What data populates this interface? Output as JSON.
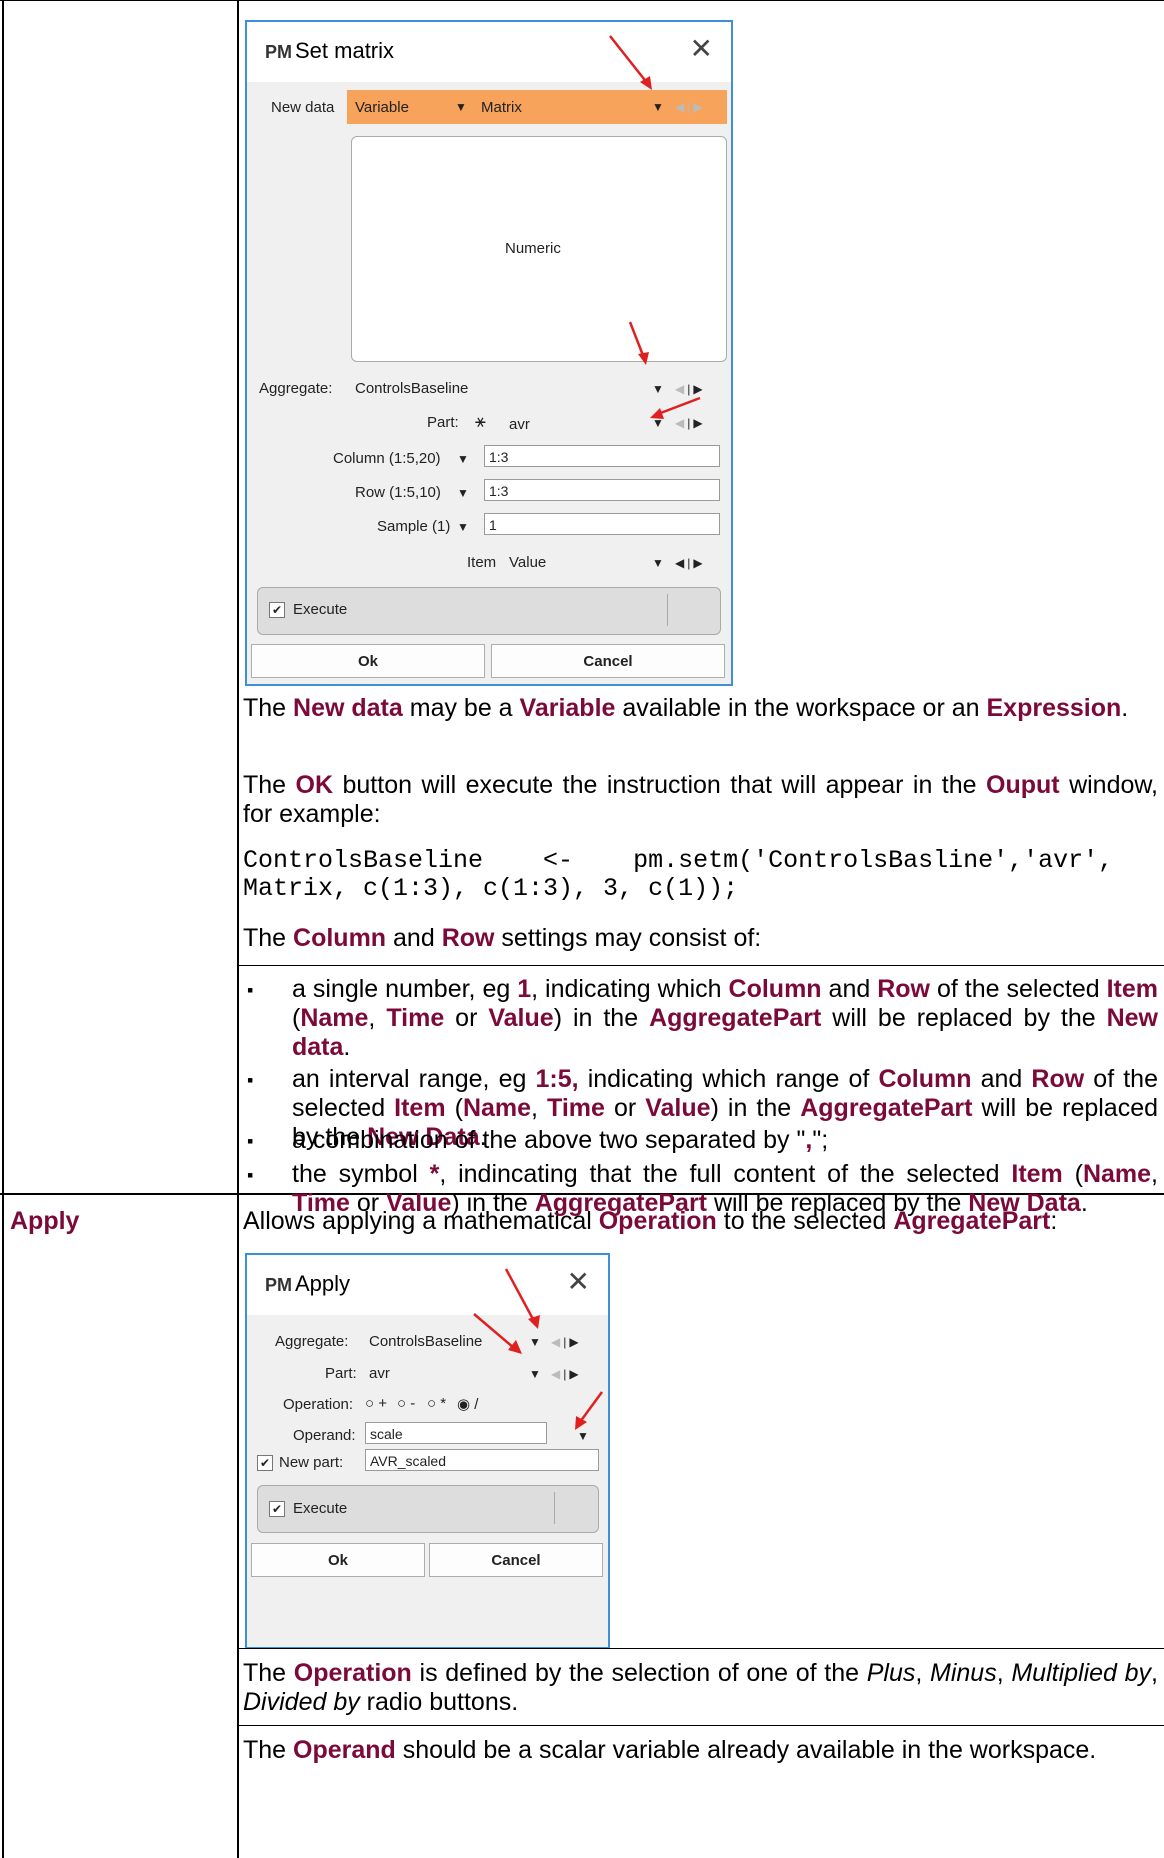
{
  "set_matrix_dialog": {
    "title": "Set matrix",
    "logo": "PM",
    "new_data_label": "New data",
    "new_data_type": "Variable",
    "new_data_value": "Matrix",
    "list_item": "Numeric",
    "aggregate_label": "Aggregate:",
    "aggregate_value": "ControlsBaseline",
    "part_label": "Part:",
    "part_value": "avr",
    "column_label": "Column (1:5,20)",
    "column_value": "1:3",
    "row_label": "Row (1:5,10)",
    "row_value": "1:3",
    "sample_label": "Sample (1)",
    "sample_value": "1",
    "item_label": "Item",
    "item_value": "Value",
    "execute_label": "Execute",
    "ok_label": "Ok",
    "cancel_label": "Cancel",
    "accent_color": "#f7a35c"
  },
  "setmatrix_text": {
    "p1": [
      "The ",
      "New data",
      " may be a ",
      "Variable",
      " available in the workspace or an ",
      "Expression",
      "."
    ],
    "p2": [
      "The ",
      "OK",
      " button will execute the instruction that will appear in the ",
      "Ouput",
      " window, for example:"
    ],
    "code_line1": "ControlsBaseline    <-    pm.setm('ControlsBasline','avr',",
    "code_line2": "Matrix, c(1:3), c(1:3), 3, c(1));",
    "p3": [
      "The ",
      "Column",
      " and ",
      "Row",
      " settings may consist of:"
    ],
    "bullets": [
      [
        "a single number, eg ",
        "1",
        ", indicating which ",
        "Column",
        " and ",
        "Row",
        " of the selected ",
        "Item",
        " (",
        "Name",
        ", ",
        "Time",
        " or ",
        "Value",
        ") in the ",
        "AggregatePart",
        " will be replaced by the ",
        "New data",
        "."
      ],
      [
        "an interval range, eg ",
        "1:5,",
        "  indicating which range of ",
        "Column",
        " and ",
        "Row",
        " of the selected ",
        "Item",
        " (",
        "Name",
        ", ",
        "Time",
        " or ",
        "Value",
        ")  in the ",
        "AggregatePart",
        " will be replaced by the ",
        "New Data",
        "."
      ],
      [
        "a combination of the above two separated by \"",
        ",",
        "\";"
      ],
      [
        "the symbol ",
        "*",
        ", indincating that the full content of the selected ",
        "Item",
        " (",
        "Name",
        ", ",
        "Time",
        " or ",
        "Value",
        ") in the ",
        "AggregatePart",
        " will be replaced by the ",
        "New Data",
        "."
      ]
    ]
  },
  "apply_row": {
    "term": "Apply",
    "intro": [
      "Allows applying a mathematical ",
      "Operation",
      " to the selected ",
      "AgregatePart",
      ":"
    ]
  },
  "apply_dialog": {
    "title": "Apply",
    "logo": "PM",
    "aggregate_label": "Aggregate:",
    "aggregate_value": "ControlsBaseline",
    "part_label": "Part:",
    "part_value": "avr",
    "operation_label": "Operation:",
    "operations": [
      "+",
      "-",
      "*",
      "/"
    ],
    "selected_operation": "/",
    "operand_label": "Operand:",
    "operand_value": "scale",
    "new_part_label": "New part:",
    "new_part_value": "AVR_scaled",
    "execute_label": "Execute",
    "ok_label": "Ok",
    "cancel_label": "Cancel"
  },
  "apply_text": {
    "p1": [
      "The ",
      "Operation",
      " is defined by the selection of one of the ",
      "Plus",
      ", ",
      "Minus",
      ", ",
      "Multiplied by",
      ", ",
      "Divided by",
      " radio buttons."
    ],
    "p2": [
      "The ",
      "Operand",
      " should be a scalar variable already available in the workspace."
    ]
  },
  "icons": {
    "close": "close-icon",
    "dropdown": "chevron-down-icon",
    "arrow_annotation": "red-arrow-icon"
  },
  "colors": {
    "term": "#7b0a3a",
    "annotation_arrow": "#e02020",
    "dialog_border": "#3f8fd6"
  }
}
